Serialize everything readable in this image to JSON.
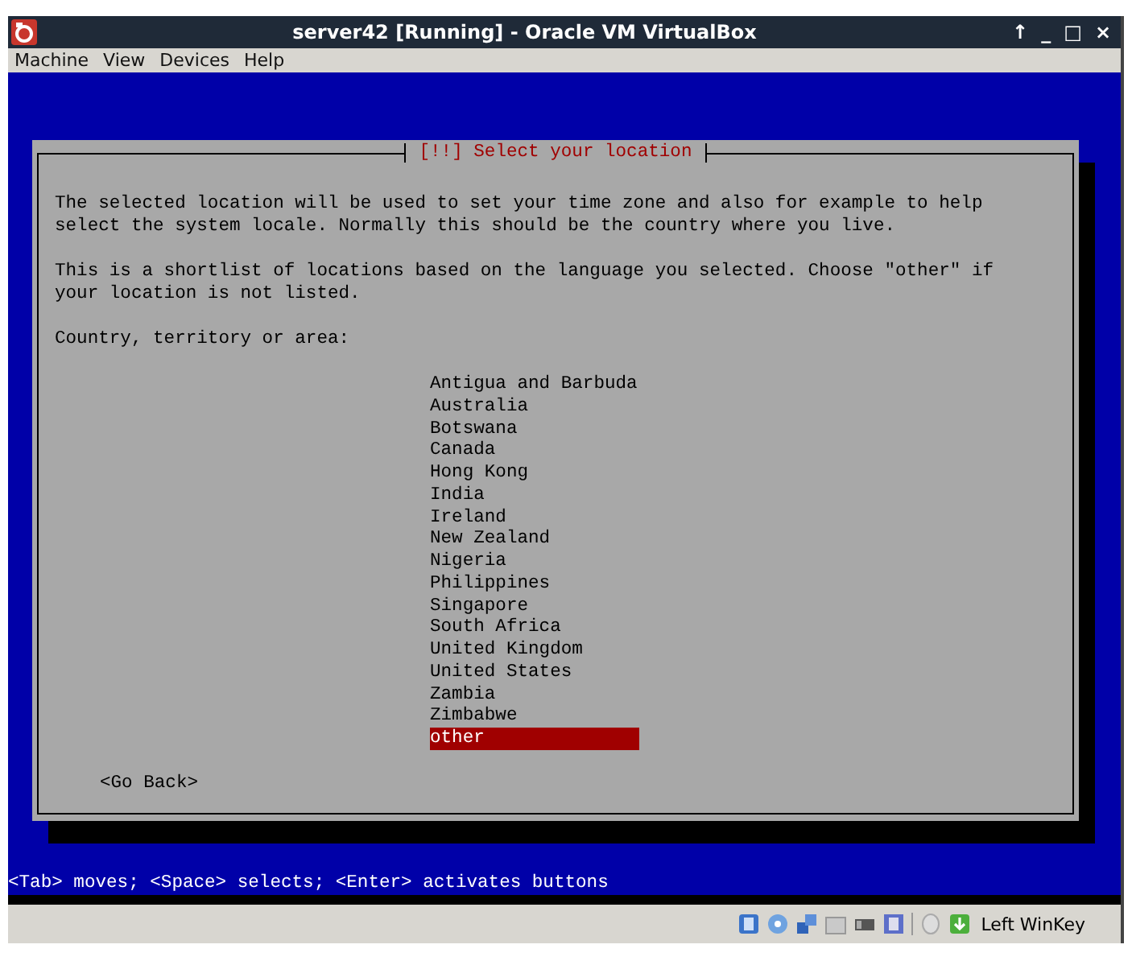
{
  "window": {
    "title": "server42 [Running] - Oracle VM VirtualBox",
    "controls": [
      "↑",
      "_",
      "□",
      "×"
    ]
  },
  "menu": [
    "Machine",
    "View",
    "Devices",
    "Help"
  ],
  "dialog": {
    "title": "[!!] Select your location",
    "paragraphs": [
      "The selected location will be used to set your time zone and also for example to help select the system locale. Normally this should be the country where you live.",
      "This is a shortlist of locations based on the language you selected. Choose \"other\" if your location is not listed."
    ],
    "prompt": "Country, territory or area:",
    "options": [
      {
        "label": "Antigua and Barbuda",
        "selected": false
      },
      {
        "label": "Australia",
        "selected": false
      },
      {
        "label": "Botswana",
        "selected": false
      },
      {
        "label": "Canada",
        "selected": false
      },
      {
        "label": "Hong Kong",
        "selected": false
      },
      {
        "label": "India",
        "selected": false
      },
      {
        "label": "Ireland",
        "selected": false
      },
      {
        "label": "New Zealand",
        "selected": false
      },
      {
        "label": "Nigeria",
        "selected": false
      },
      {
        "label": "Philippines",
        "selected": false
      },
      {
        "label": "Singapore",
        "selected": false
      },
      {
        "label": "South Africa",
        "selected": false
      },
      {
        "label": "United Kingdom",
        "selected": false
      },
      {
        "label": "United States",
        "selected": false
      },
      {
        "label": "Zambia",
        "selected": false
      },
      {
        "label": "Zimbabwe",
        "selected": false
      },
      {
        "label": "other",
        "selected": true
      }
    ],
    "back_button": "<Go Back>"
  },
  "help_line": "<Tab> moves; <Space> selects; <Enter> activates buttons",
  "status_bar": {
    "host_key": "Left WinKey"
  }
}
